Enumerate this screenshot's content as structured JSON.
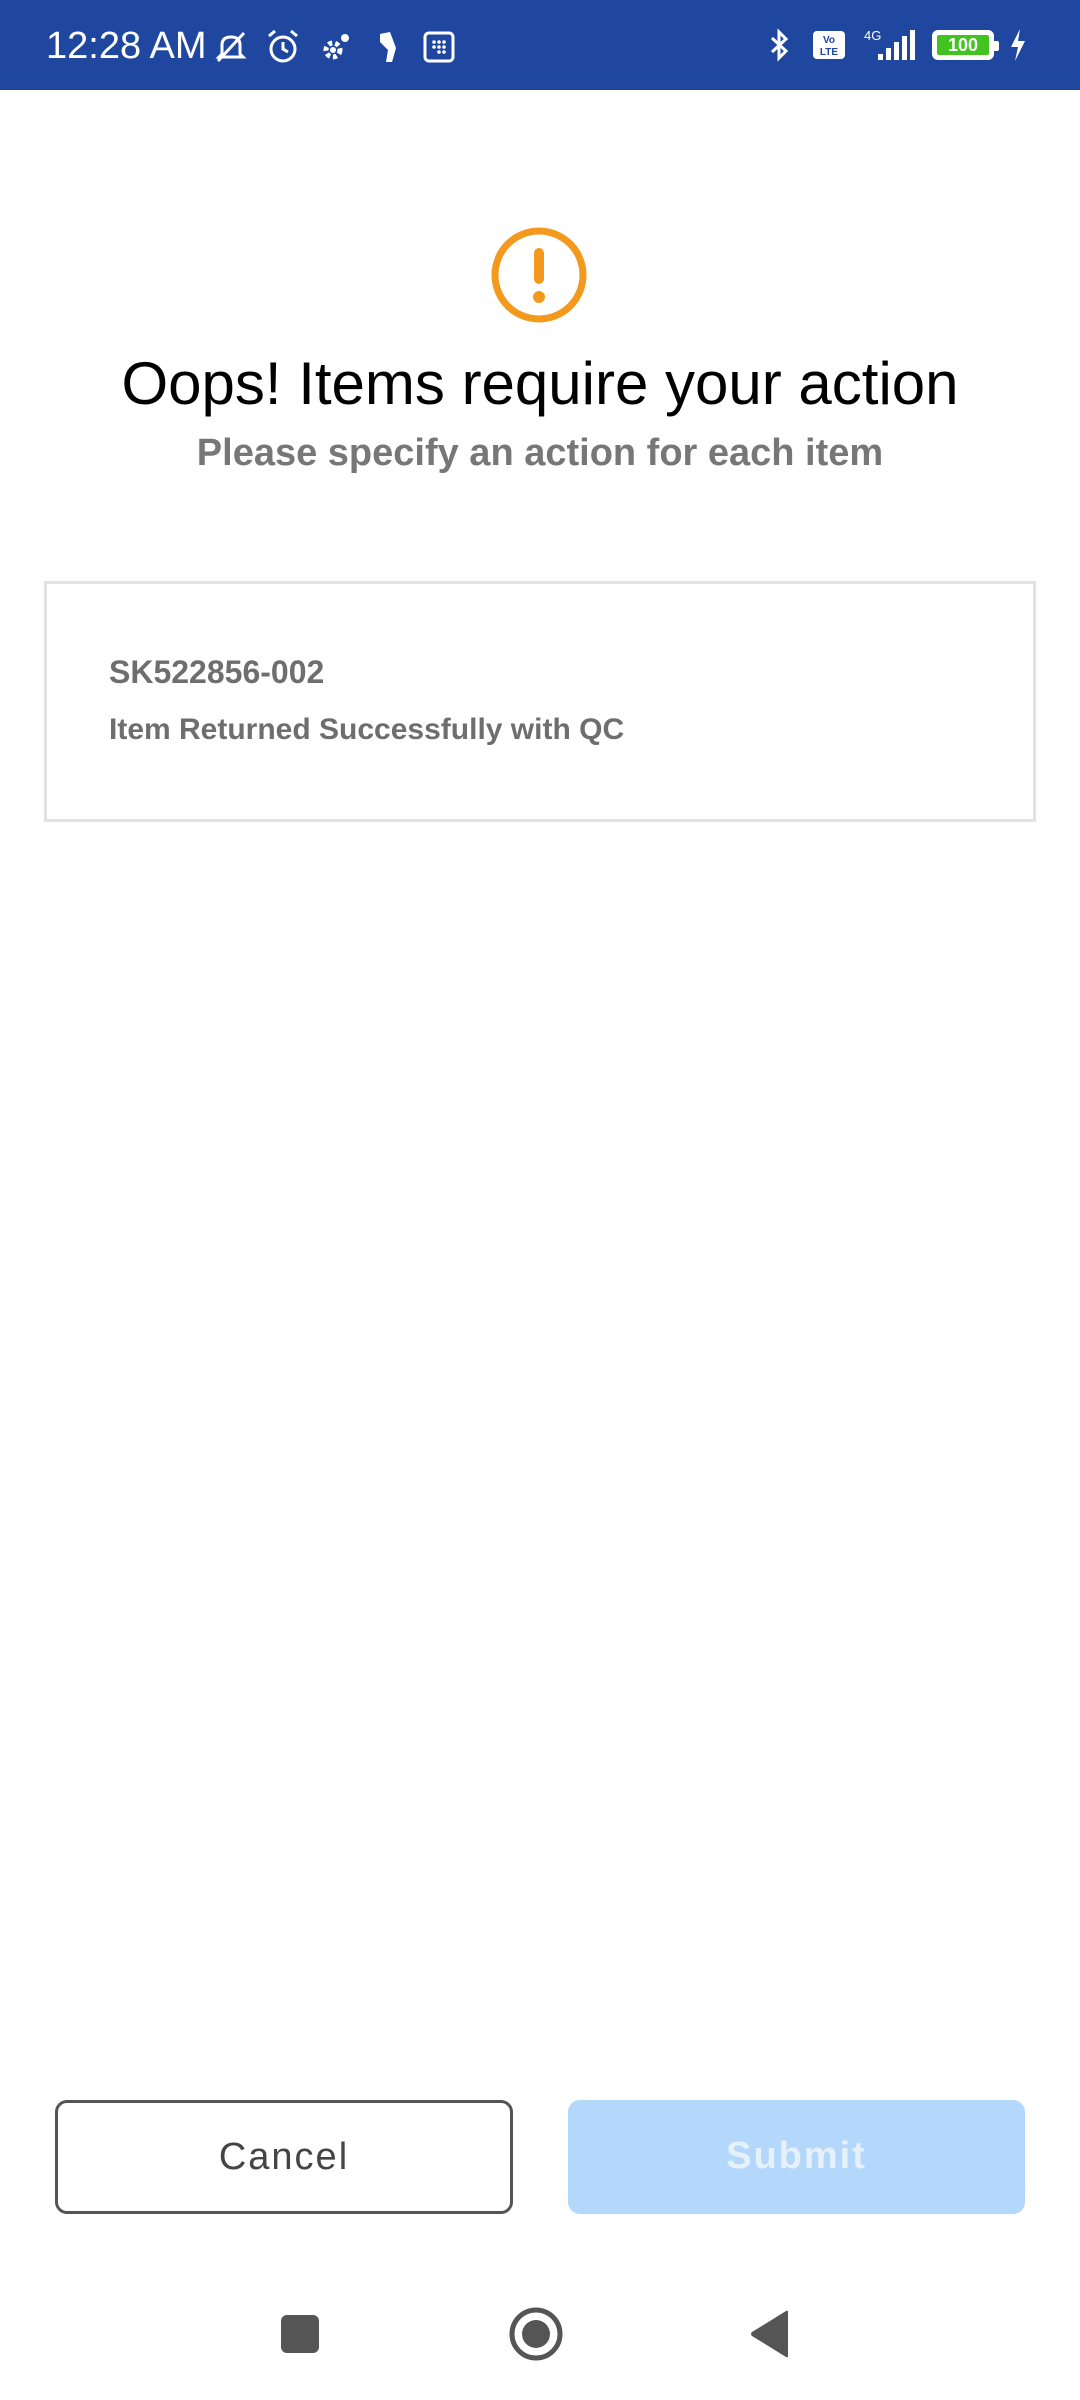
{
  "status_bar": {
    "time": "12:28 AM",
    "battery_level": "100",
    "network": "4G",
    "left_icons": [
      "mute-icon",
      "alarm-icon",
      "settings-icon",
      "app-icon",
      "grid-app-icon"
    ],
    "right_icons": [
      "bluetooth-icon",
      "volte-icon",
      "signal-icon",
      "battery-icon",
      "charging-icon"
    ],
    "background_color": "#1f47a0",
    "battery_color": "#43c31f"
  },
  "dialog": {
    "icon": "warning-icon",
    "icon_color": "#f39a1e",
    "title": "Oops! Items require your action",
    "subtitle": "Please specify an action for each item"
  },
  "items": [
    {
      "sku": "SK522856-002",
      "status": "Item Returned Successfully with QC"
    }
  ],
  "actions": {
    "cancel_label": "Cancel",
    "submit_label": "Submit",
    "submit_color": "#b3d8fb"
  },
  "nav": {
    "icons": [
      "recent-apps-icon",
      "home-icon",
      "back-icon"
    ]
  }
}
